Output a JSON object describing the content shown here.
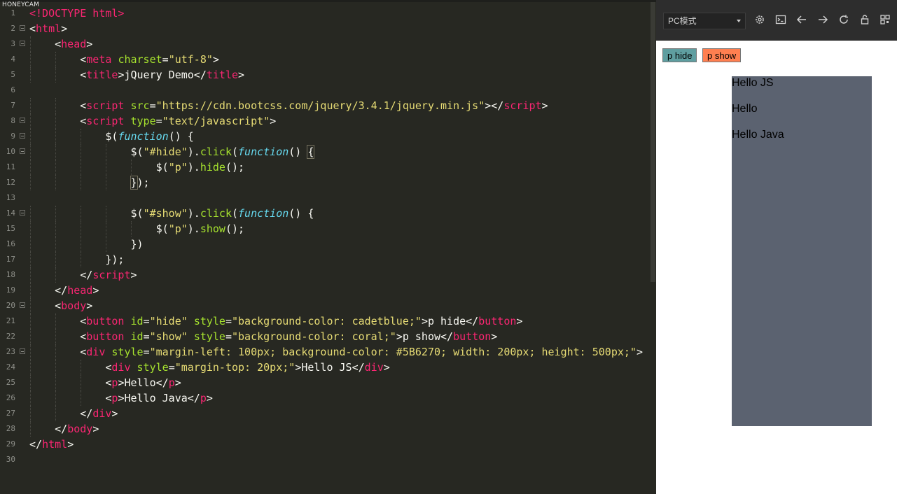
{
  "watermark": "HONEYCAM",
  "editor": {
    "lines": [
      {
        "n": "1",
        "fold": false,
        "html": "<span class=\"tag\">&lt;!DOCTYPE html&gt;</span>"
      },
      {
        "n": "2",
        "fold": true,
        "html": "<span class=\"p\">&lt;</span><span class=\"tag\">html</span><span class=\"p\">&gt;</span>"
      },
      {
        "n": "3",
        "fold": true,
        "html": "    <span class=\"p\">&lt;</span><span class=\"tag\">head</span><span class=\"p\">&gt;</span>"
      },
      {
        "n": "4",
        "fold": false,
        "html": "        <span class=\"p\">&lt;</span><span class=\"tag\">meta</span> <span class=\"attr\">charset</span>=<span class=\"str\">\"utf-8\"</span><span class=\"p\">&gt;</span>"
      },
      {
        "n": "5",
        "fold": false,
        "html": "        <span class=\"p\">&lt;</span><span class=\"tag\">title</span><span class=\"p\">&gt;jQuery Demo&lt;/</span><span class=\"tag\">title</span><span class=\"p\">&gt;</span>"
      },
      {
        "n": "6",
        "fold": false,
        "html": ""
      },
      {
        "n": "7",
        "fold": false,
        "html": "        <span class=\"p\">&lt;</span><span class=\"tag\">script</span> <span class=\"attr\">src</span>=<span class=\"str\">\"https://cdn.bootcss.com/jquery/3.4.1/jquery.min.js\"</span><span class=\"p\">&gt;&lt;/</span><span class=\"tag\">script</span><span class=\"p\">&gt;</span>"
      },
      {
        "n": "8",
        "fold": true,
        "html": "        <span class=\"p\">&lt;</span><span class=\"tag\">script</span> <span class=\"attr\">type</span>=<span class=\"str\">\"text/javascript\"</span><span class=\"p\">&gt;</span>"
      },
      {
        "n": "9",
        "fold": true,
        "html": "            <span class=\"p\">$(</span><span class=\"kw\">function</span><span class=\"p\">() {</span>"
      },
      {
        "n": "10",
        "fold": true,
        "html": "                <span class=\"p\">$(</span><span class=\"str\">\"#hide\"</span><span class=\"p\">).</span><span class=\"fn\">click</span><span class=\"p\">(</span><span class=\"kw\">function</span><span class=\"p\">() </span><span class=\"p bracket-hl\">{</span>"
      },
      {
        "n": "11",
        "fold": false,
        "html": "                    <span class=\"p\">$(</span><span class=\"str\">\"p\"</span><span class=\"p\">).</span><span class=\"fn\">hide</span><span class=\"p\">();</span>"
      },
      {
        "n": "12",
        "fold": false,
        "html": "                <span class=\"p bracket-hl\">}</span><span class=\"p\">);</span>"
      },
      {
        "n": "13",
        "fold": false,
        "html": ""
      },
      {
        "n": "14",
        "fold": true,
        "html": "                <span class=\"p\">$(</span><span class=\"str\">\"#show\"</span><span class=\"p\">).</span><span class=\"fn\">click</span><span class=\"p\">(</span><span class=\"kw\">function</span><span class=\"p\">() {</span>"
      },
      {
        "n": "15",
        "fold": false,
        "html": "                    <span class=\"p\">$(</span><span class=\"str\">\"p\"</span><span class=\"p\">).</span><span class=\"fn\">show</span><span class=\"p\">();</span>"
      },
      {
        "n": "16",
        "fold": false,
        "html": "                <span class=\"p\">})</span>"
      },
      {
        "n": "17",
        "fold": false,
        "html": "            <span class=\"p\">});</span>"
      },
      {
        "n": "18",
        "fold": false,
        "html": "        <span class=\"p\">&lt;/</span><span class=\"tag\">script</span><span class=\"p\">&gt;</span>"
      },
      {
        "n": "19",
        "fold": false,
        "html": "    <span class=\"p\">&lt;/</span><span class=\"tag\">head</span><span class=\"p\">&gt;</span>"
      },
      {
        "n": "20",
        "fold": true,
        "html": "    <span class=\"p\">&lt;</span><span class=\"tag\">body</span><span class=\"p\">&gt;</span>"
      },
      {
        "n": "21",
        "fold": false,
        "html": "        <span class=\"p\">&lt;</span><span class=\"tag\">button</span> <span class=\"attr\">id</span>=<span class=\"str\">\"hide\"</span> <span class=\"attr\">style</span>=<span class=\"str\">\"background-color: cadetblue;\"</span><span class=\"p\">&gt;p hide&lt;/</span><span class=\"tag\">button</span><span class=\"p\">&gt;</span>"
      },
      {
        "n": "22",
        "fold": false,
        "html": "        <span class=\"p\">&lt;</span><span class=\"tag\">button</span> <span class=\"attr\">id</span>=<span class=\"str\">\"show\"</span> <span class=\"attr\">style</span>=<span class=\"str\">\"background-color: coral;\"</span><span class=\"p\">&gt;p show&lt;/</span><span class=\"tag\">button</span><span class=\"p\">&gt;</span>"
      },
      {
        "n": "23",
        "fold": true,
        "html": "        <span class=\"p\">&lt;</span><span class=\"tag\">div</span> <span class=\"attr\">style</span>=<span class=\"str\">\"margin-left: 100px; background-color: #5B6270; width: 200px; height: 500px;\"</span><span class=\"p\">&gt;</span>"
      },
      {
        "n": "24",
        "fold": false,
        "html": "            <span class=\"p\">&lt;</span><span class=\"tag\">div</span> <span class=\"attr\">style</span>=<span class=\"str\">\"margin-top: 20px;\"</span><span class=\"p\">&gt;Hello JS&lt;/</span><span class=\"tag\">div</span><span class=\"p\">&gt;</span>"
      },
      {
        "n": "25",
        "fold": false,
        "html": "            <span class=\"p\">&lt;</span><span class=\"tag\">p</span><span class=\"p\">&gt;Hello&lt;/</span><span class=\"tag\">p</span><span class=\"p\">&gt;</span>"
      },
      {
        "n": "26",
        "fold": false,
        "html": "            <span class=\"p\">&lt;</span><span class=\"tag\">p</span><span class=\"p\">&gt;Hello Java&lt;/</span><span class=\"tag\">p</span><span class=\"p\">&gt;</span>"
      },
      {
        "n": "27",
        "fold": false,
        "html": "        <span class=\"p\">&lt;/</span><span class=\"tag\">div</span><span class=\"p\">&gt;</span>"
      },
      {
        "n": "28",
        "fold": false,
        "html": "    <span class=\"p\">&lt;/</span><span class=\"tag\">body</span><span class=\"p\">&gt;</span>"
      },
      {
        "n": "29",
        "fold": false,
        "html": "<span class=\"p\">&lt;/</span><span class=\"tag\">html</span><span class=\"p\">&gt;</span>"
      },
      {
        "n": "30",
        "fold": false,
        "html": ""
      }
    ]
  },
  "preview": {
    "mode_select": "PC模式",
    "toolbar_icons": [
      "gear-icon",
      "terminal-icon",
      "arrow-left-icon",
      "arrow-right-icon",
      "refresh-icon",
      "unlock-icon",
      "qr-code-icon"
    ],
    "hide_button": "p hide",
    "show_button": "p show",
    "box_div_text": "Hello JS",
    "box_p1": "Hello",
    "box_p2": "Hello Java",
    "colors": {
      "hide_bg": "#5f9ea0",
      "show_bg": "#ff7f50",
      "box_bg": "#5b6270",
      "editor_bg": "#272822"
    }
  }
}
